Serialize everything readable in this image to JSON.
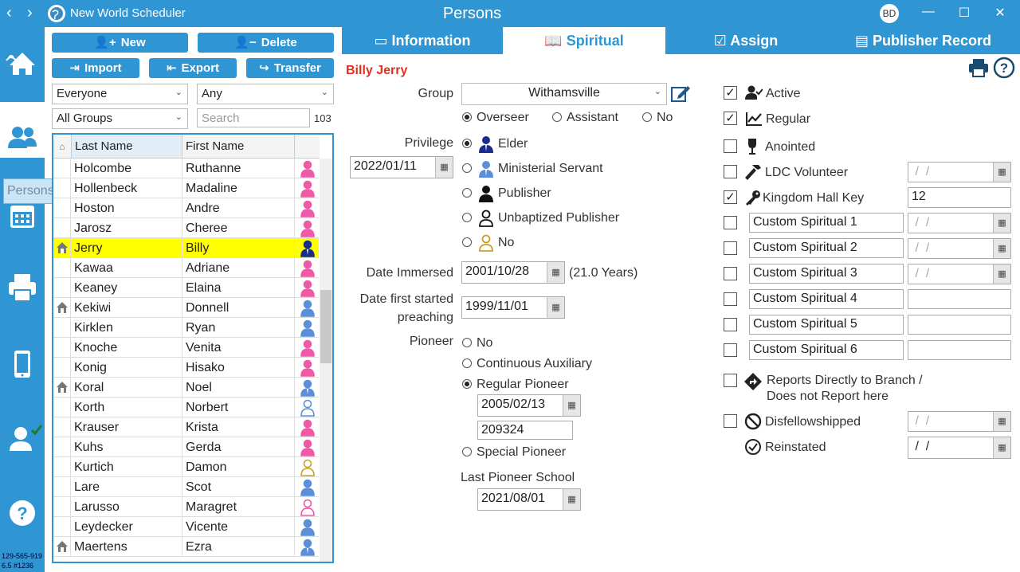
{
  "titlebar": {
    "app_title": "New World Scheduler",
    "page_title": "Persons",
    "avatar_initials": "BD",
    "back": "‹",
    "forward": "›",
    "minimize": "—",
    "maximize": "☐",
    "close": "✕"
  },
  "sidebar": {
    "tooltip": "Persons",
    "build_line1": "129-565-919",
    "build_line2": "6.5 #1236"
  },
  "toolbar": {
    "new": "New",
    "delete": "Delete",
    "import": "Import",
    "export": "Export",
    "transfer": "Transfer"
  },
  "filters": {
    "who": "Everyone",
    "any": "Any",
    "group": "All Groups",
    "search_placeholder": "Search",
    "count": "103"
  },
  "grid": {
    "col_last": "Last Name",
    "col_first": "First Name",
    "rows": [
      {
        "last": "Holcombe",
        "first": "Ruthanne",
        "home": false,
        "type": "female"
      },
      {
        "last": "Hollenbeck",
        "first": "Madaline",
        "home": false,
        "type": "female"
      },
      {
        "last": "Hoston",
        "first": "Andre",
        "home": false,
        "type": "female"
      },
      {
        "last": "Jarosz",
        "first": "Cheree",
        "home": false,
        "type": "female"
      },
      {
        "last": "Jerry",
        "first": "Billy",
        "home": true,
        "type": "elder"
      },
      {
        "last": "Kawaa",
        "first": "Adriane",
        "home": false,
        "type": "female"
      },
      {
        "last": "Keaney",
        "first": "Elaina",
        "home": false,
        "type": "female"
      },
      {
        "last": "Kekiwi",
        "first": "Donnell",
        "home": true,
        "type": "male"
      },
      {
        "last": "Kirklen",
        "first": "Ryan",
        "home": false,
        "type": "male"
      },
      {
        "last": "Knoche",
        "first": "Venita",
        "home": false,
        "type": "female"
      },
      {
        "last": "Konig",
        "first": "Hisako",
        "home": false,
        "type": "female"
      },
      {
        "last": "Koral",
        "first": "Noel",
        "home": true,
        "type": "ms"
      },
      {
        "last": "Korth",
        "first": "Norbert",
        "home": false,
        "type": "male-outline"
      },
      {
        "last": "Krauser",
        "first": "Krista",
        "home": false,
        "type": "female"
      },
      {
        "last": "Kuhs",
        "first": "Gerda",
        "home": false,
        "type": "female"
      },
      {
        "last": "Kurtich",
        "first": "Damon",
        "home": false,
        "type": "no"
      },
      {
        "last": "Lare",
        "first": "Scot",
        "home": false,
        "type": "male"
      },
      {
        "last": "Larusso",
        "first": "Maragret",
        "home": false,
        "type": "female-outline"
      },
      {
        "last": "Leydecker",
        "first": "Vicente",
        "home": false,
        "type": "male"
      },
      {
        "last": "Maertens",
        "first": "Ezra",
        "home": true,
        "type": "ms"
      }
    ]
  },
  "tabs": {
    "information": "Information",
    "spiritual": "Spiritual",
    "assign": "Assign",
    "publisher_record": "Publisher Record"
  },
  "person": {
    "name": "Billy Jerry"
  },
  "form": {
    "group_label": "Group",
    "group_value": "Withamsville",
    "role_overseer": "Overseer",
    "role_assistant": "Assistant",
    "role_no": "No",
    "privilege_label": "Privilege",
    "privilege_date": "2022/01/11",
    "priv_elder": "Elder",
    "priv_ms": "Ministerial Servant",
    "priv_publisher": "Publisher",
    "priv_unbaptized": "Unbaptized Publisher",
    "priv_no": "No",
    "immersed_label": "Date Immersed",
    "immersed_date": "2001/10/28",
    "immersed_years": "(21.0 Years)",
    "started_label_1": "Date first started",
    "started_label_2": "preaching",
    "started_date": "1999/11/01",
    "pioneer_label": "Pioneer",
    "pioneer_no": "No",
    "pioneer_cont_aux": "Continuous Auxiliary",
    "pioneer_regular": "Regular Pioneer",
    "pioneer_date": "2005/02/13",
    "pioneer_number": "209324",
    "pioneer_special": "Special Pioneer",
    "school_label": "Last Pioneer School",
    "school_date": "2021/08/01"
  },
  "right": {
    "active": "Active",
    "regular": "Regular",
    "anointed": "Anointed",
    "ldc": "LDC Volunteer",
    "kh_key": "Kingdom Hall Key",
    "kh_key_value": "12",
    "empty_date": " /  /",
    "custom1": "Custom Spiritual 1",
    "custom2": "Custom Spiritual 2",
    "custom3": "Custom Spiritual 3",
    "custom4": "Custom Spiritual 4",
    "custom5": "Custom Spiritual 5",
    "custom6": "Custom Spiritual 6",
    "branch_1": "Reports Directly to Branch /",
    "branch_2": "Does not Report here",
    "disfellowshipped": "Disfellowshipped",
    "reinstated": "Reinstated"
  },
  "colors": {
    "accent": "#2f95d3",
    "name_red": "#e0301e",
    "female": "#ee5aa5",
    "male": "#5b8fd9",
    "elder": "#1a2d8a",
    "no": "#c8a02a"
  }
}
